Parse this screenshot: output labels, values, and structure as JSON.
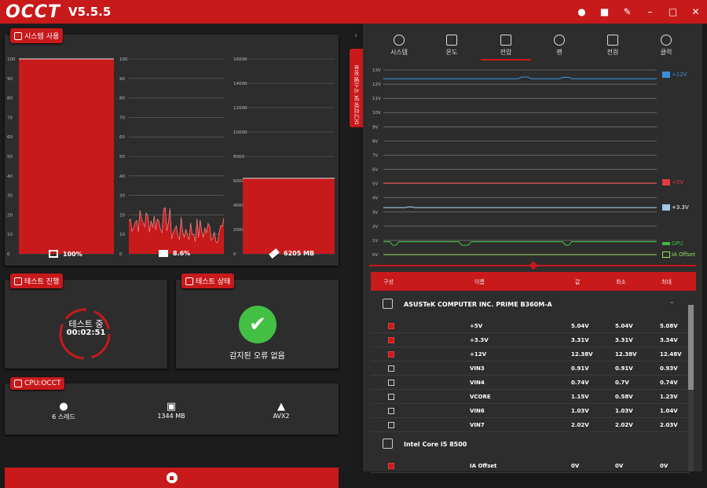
{
  "app": {
    "title": "OCCT",
    "version": "V5.5.5"
  },
  "titlebar_icons": [
    "info-icon",
    "camera-icon",
    "wrench-icon",
    "minimize-icon",
    "maximize-icon",
    "close-icon"
  ],
  "system_usage": {
    "label": "시스템 사용",
    "cpu": {
      "axis": [
        "100",
        "90",
        "80",
        "70",
        "60",
        "50",
        "40",
        "30",
        "20",
        "10",
        "0"
      ],
      "value_label": "100%",
      "value": 100
    },
    "gpu": {
      "axis": [
        "100",
        "90",
        "80",
        "70",
        "60",
        "50",
        "40",
        "30",
        "20",
        "10",
        "0"
      ],
      "value_label": "8.6%",
      "value": 8.6
    },
    "ram": {
      "axis": [
        "16000",
        "14000",
        "12000",
        "10000",
        "8000",
        "6000",
        "4000",
        "2000",
        "0"
      ],
      "value_label": "6205 MB",
      "value": 6205
    }
  },
  "test_progress": {
    "label": "테스트 진행",
    "status": "테스트 중",
    "time": "00:02:51"
  },
  "test_status": {
    "label": "테스트 상태",
    "message": "감지된 오류 없음"
  },
  "cpu_test": {
    "label": "CPU:OCCT",
    "threads": "6 스레드",
    "memory": "1344 MB",
    "instruction": "AVX2"
  },
  "side_tab": {
    "label": "모니터링 및 시스템 정보"
  },
  "monitor": {
    "tabs": [
      "시스템",
      "온도",
      "전압",
      "팬",
      "전원",
      "클럭"
    ],
    "active_tab": "전압",
    "y_axis": [
      "13V",
      "12V",
      "11V",
      "10V",
      "9V",
      "8V",
      "7V",
      "6V",
      "5V",
      "4V",
      "3V",
      "2V",
      "1V",
      "0V"
    ],
    "series": [
      {
        "name": "+12V",
        "color": "#3b8fd9"
      },
      {
        "name": "+5V",
        "color": "#e33b3d"
      },
      {
        "name": "+3.3V",
        "color": "#a0c8e8"
      },
      {
        "name": "GPU",
        "color": "#3fb83f"
      },
      {
        "name": "IA Offset",
        "color": "#9be05a"
      }
    ]
  },
  "table": {
    "headers": {
      "config": "구성",
      "name": "이름",
      "value": "값",
      "min": "최소",
      "max": "최대"
    },
    "groups": [
      {
        "name": "ASUSTeK COMPUTER INC. PRIME B360M-A",
        "rows": [
          {
            "checked": true,
            "name": "+5V",
            "value": "5.04V",
            "min": "5.04V",
            "max": "5.08V"
          },
          {
            "checked": true,
            "name": "+3.3V",
            "value": "3.31V",
            "min": "3.31V",
            "max": "3.34V"
          },
          {
            "checked": true,
            "name": "+12V",
            "value": "12.38V",
            "min": "12.38V",
            "max": "12.48V"
          },
          {
            "checked": false,
            "name": "VIN3",
            "value": "0.91V",
            "min": "0.91V",
            "max": "0.93V"
          },
          {
            "checked": false,
            "name": "VIN4",
            "value": "0.74V",
            "min": "0.7V",
            "max": "0.74V"
          },
          {
            "checked": false,
            "name": "VCORE",
            "value": "1.15V",
            "min": "0.58V",
            "max": "1.23V"
          },
          {
            "checked": false,
            "name": "VIN6",
            "value": "1.03V",
            "min": "1.03V",
            "max": "1.04V"
          },
          {
            "checked": false,
            "name": "VIN7",
            "value": "2.02V",
            "min": "2.02V",
            "max": "2.03V"
          }
        ]
      },
      {
        "name": "Intel Core i5 8500",
        "rows": [
          {
            "checked": true,
            "name": "IA Offset",
            "value": "0V",
            "min": "0V",
            "max": "0V"
          }
        ]
      }
    ]
  }
}
